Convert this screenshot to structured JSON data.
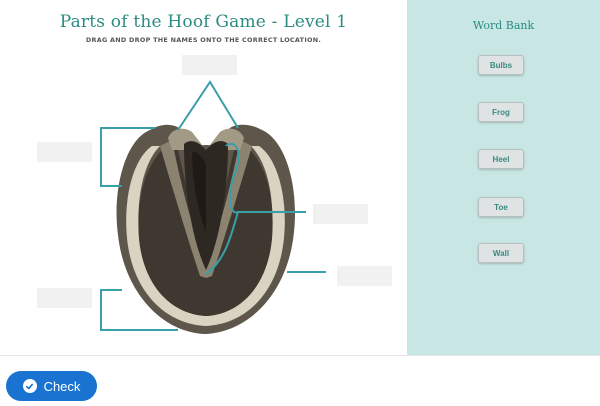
{
  "game": {
    "title": "Parts of the Hoof Game - Level 1",
    "instructions": "DRAG AND DROP THE NAMES ONTO THE CORRECT LOCATION."
  },
  "word_bank": {
    "title": "Word Bank",
    "words": [
      "Bulbs",
      "Frog",
      "Heel",
      "Toe",
      "Wall"
    ]
  },
  "footer": {
    "check_label": "Check",
    "check_icon": "check-circle-icon"
  },
  "colors": {
    "accent": "#2a8c82",
    "word_bank_bg": "#c8e6e4",
    "check_button": "#1a73d1",
    "pointer_line": "#3b9fa8"
  }
}
